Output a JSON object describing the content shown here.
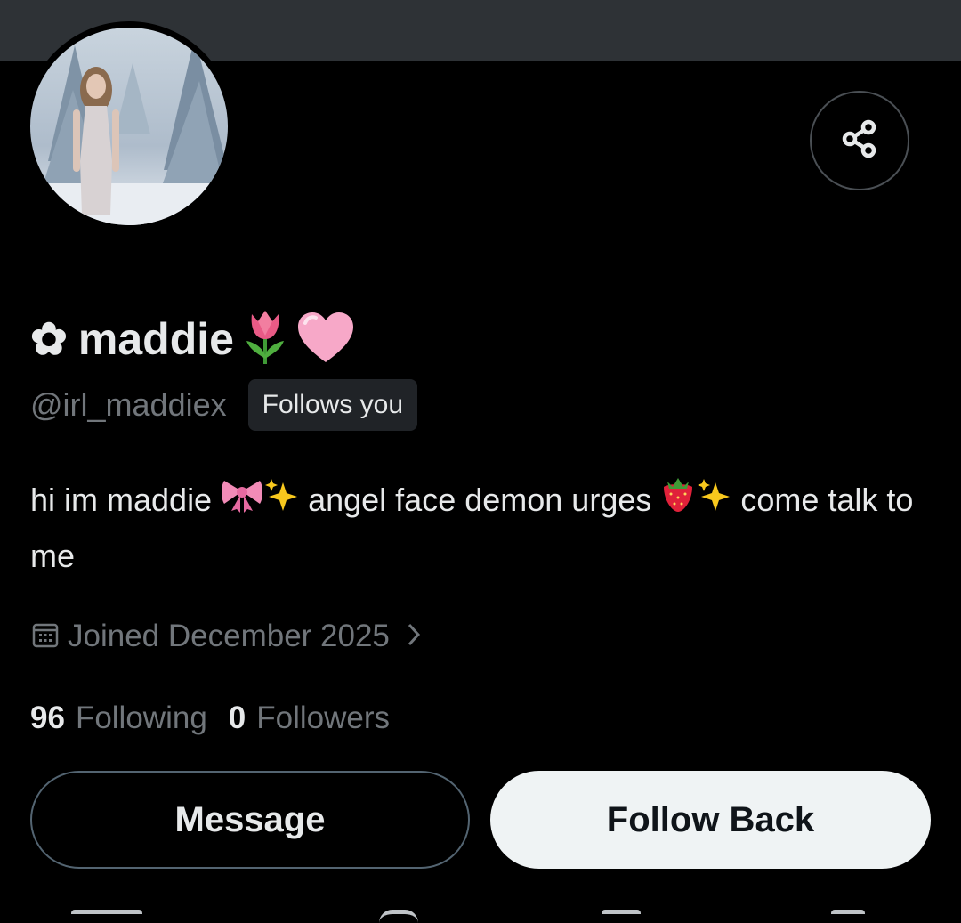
{
  "profile": {
    "name_prefix": "✿",
    "name": "maddie",
    "name_emoji_1": "🌷",
    "name_emoji_2": "🩷",
    "handle": "@irl_maddiex",
    "follows_badge": "Follows you",
    "bio": {
      "part1": "hi im maddie ",
      "emoji_bow": "🎀",
      "emoji_sparkles_1": "✨",
      "part2": " angel face demon urges ",
      "emoji_strawberry": "🍓",
      "emoji_sparkles_2": "✨",
      "part3": " come talk to me"
    },
    "joined": "Joined December 2025",
    "following_count": "96",
    "following_label": "Following",
    "followers_count": "0",
    "followers_label": "Followers"
  },
  "actions": {
    "message_label": "Message",
    "follow_back_label": "Follow Back"
  },
  "icons": {
    "share": "share-icon",
    "calendar": "calendar-icon",
    "chevron": "chevron-right-icon"
  },
  "colors": {
    "background": "#000000",
    "banner": "#2e3236",
    "primary_text": "#e7e9ea",
    "secondary_text": "#71767b",
    "badge_bg": "#202327",
    "follow_button_bg": "#eff3f4"
  }
}
